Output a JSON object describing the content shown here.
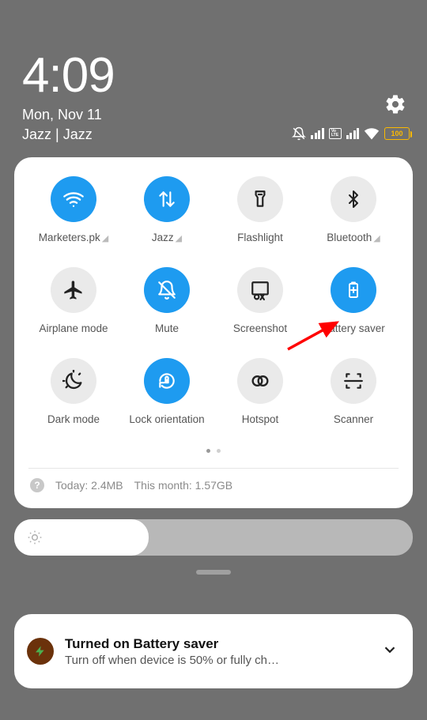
{
  "header": {
    "time": "4:09",
    "date": "Mon, Nov 11",
    "carrier": "Jazz | Jazz",
    "lte_badge": "Vo LTE",
    "battery_text": "100"
  },
  "tiles": [
    {
      "label": "Marketers.pk",
      "icon": "wifi-icon",
      "active": true,
      "arrow": true
    },
    {
      "label": "Jazz",
      "icon": "data-swap-icon",
      "active": true,
      "arrow": true
    },
    {
      "label": "Flashlight",
      "icon": "flashlight-icon",
      "active": false,
      "arrow": false
    },
    {
      "label": "Bluetooth",
      "icon": "bluetooth-icon",
      "active": false,
      "arrow": true
    },
    {
      "label": "Airplane mode",
      "icon": "airplane-icon",
      "active": false,
      "arrow": false
    },
    {
      "label": "Mute",
      "icon": "mute-bell-icon",
      "active": true,
      "arrow": false
    },
    {
      "label": "Screenshot",
      "icon": "screenshot-icon",
      "active": false,
      "arrow": false
    },
    {
      "label": "Battery saver",
      "icon": "battery-plus-icon",
      "active": true,
      "arrow": false
    },
    {
      "label": "Dark mode",
      "icon": "dark-mode-icon",
      "active": false,
      "arrow": false
    },
    {
      "label": "Lock orientation",
      "icon": "lock-rotation-icon",
      "active": true,
      "arrow": false
    },
    {
      "label": "Hotspot",
      "icon": "hotspot-icon",
      "active": false,
      "arrow": false
    },
    {
      "label": "Scanner",
      "icon": "scanner-icon",
      "active": false,
      "arrow": false
    }
  ],
  "data_usage": {
    "today_label": "Today: 2.4MB",
    "month_label": "This month: 1.57GB"
  },
  "notification": {
    "title": "Turned on Battery saver",
    "text": "Turn off when device is 50% or fully ch…"
  }
}
